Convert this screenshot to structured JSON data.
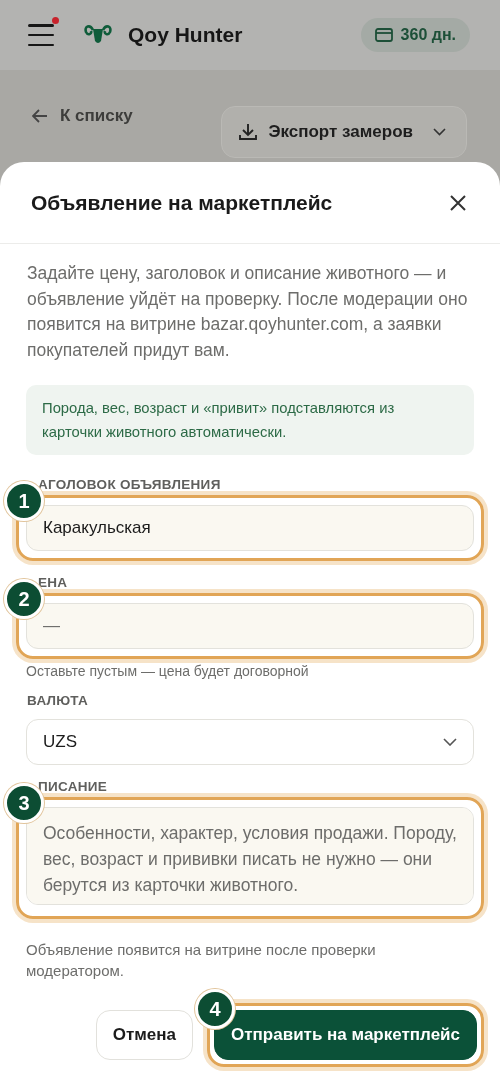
{
  "header": {
    "brand": "Qoy Hunter",
    "notification": true,
    "subscription": "360 дн."
  },
  "toolbar": {
    "back": "К списку",
    "export": "Экспорт замеров"
  },
  "dialog": {
    "title": "Объявление на маркетплейс",
    "intro": "Задайте цену, заголовок и описание животного — и объявление уйдёт на проверку. После модерации оно появится на витрине bazar.qoyhunter.com, а заявки покупателей придут вам.",
    "info": "Порода, вес, возраст и «привит» подставляются из карточки животного автоматически.",
    "fields": [
      {
        "kind": "text",
        "label": "АГОЛОВОК ОБЪЯВЛЕНИЯ",
        "value": "Каракульская",
        "step": "1",
        "highlighted": true
      },
      {
        "kind": "text",
        "label": "ЕНА",
        "placeholder": "—",
        "hint": "Оставьте пустым — цена будет договорной",
        "step": "2",
        "highlighted": true
      },
      {
        "kind": "select",
        "label": "ВАЛЮТА",
        "value": "UZS"
      },
      {
        "kind": "textarea",
        "label": "ПИСАНИЕ",
        "placeholder": "Особенности, характер, условия продажи. Породу, вес, возраст и прививки писать не нужно — они берутся из карточки животного.",
        "step": "3",
        "highlighted": true
      }
    ],
    "note": "Объявление появится на витрине после проверки модератором.",
    "buttons": [
      {
        "kind": "secondary",
        "label": "Отмена"
      },
      {
        "kind": "primary",
        "label": "Отправить на маркетплейс",
        "step": "4",
        "highlighted": true
      }
    ]
  }
}
